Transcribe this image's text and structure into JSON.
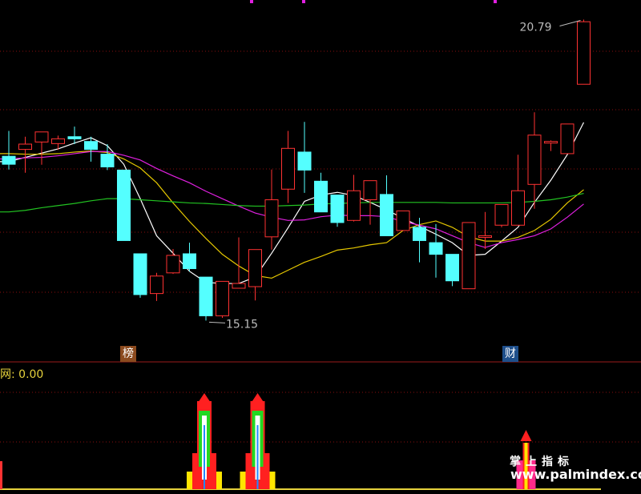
{
  "chart_data": [
    {
      "type": "candlestick",
      "grid": true,
      "ylim": [
        14.4,
        21.2
      ],
      "annotations": {
        "high": "20.79",
        "low": "15.15"
      },
      "candles": [
        {
          "o": 18.25,
          "h": 18.73,
          "l": 18.0,
          "c": 18.1
        },
        {
          "o": 18.38,
          "h": 18.62,
          "l": 17.94,
          "c": 18.48
        },
        {
          "o": 18.52,
          "h": 18.71,
          "l": 18.09,
          "c": 18.71
        },
        {
          "o": 18.49,
          "h": 18.64,
          "l": 18.37,
          "c": 18.58
        },
        {
          "o": 18.62,
          "h": 18.81,
          "l": 18.48,
          "c": 18.58
        },
        {
          "o": 18.53,
          "h": 18.62,
          "l": 18.15,
          "c": 18.38
        },
        {
          "o": 18.29,
          "h": 18.48,
          "l": 17.99,
          "c": 18.05
        },
        {
          "o": 17.99,
          "h": 17.99,
          "l": 16.66,
          "c": 16.66
        },
        {
          "o": 16.41,
          "h": 16.41,
          "l": 15.58,
          "c": 15.64
        },
        {
          "o": 15.66,
          "h": 16.05,
          "l": 15.52,
          "c": 15.99
        },
        {
          "o": 16.05,
          "h": 16.5,
          "l": 16.03,
          "c": 16.38
        },
        {
          "o": 16.41,
          "h": 16.62,
          "l": 16.08,
          "c": 16.13
        },
        {
          "o": 15.97,
          "h": 15.97,
          "l": 15.15,
          "c": 15.24
        },
        {
          "o": 15.24,
          "h": 15.89,
          "l": 15.2,
          "c": 15.89
        },
        {
          "o": 15.76,
          "h": 16.72,
          "l": 15.82,
          "c": 15.85
        },
        {
          "o": 15.79,
          "h": 16.49,
          "l": 15.53,
          "c": 16.49
        },
        {
          "o": 16.73,
          "h": 18.0,
          "l": 16.49,
          "c": 17.43
        },
        {
          "o": 17.63,
          "h": 18.73,
          "l": 17.37,
          "c": 18.4
        },
        {
          "o": 18.33,
          "h": 18.9,
          "l": 17.56,
          "c": 17.99
        },
        {
          "o": 17.78,
          "h": 17.94,
          "l": 17.2,
          "c": 17.2
        },
        {
          "o": 17.52,
          "h": 17.52,
          "l": 16.92,
          "c": 17.0
        },
        {
          "o": 17.04,
          "h": 17.9,
          "l": 17.02,
          "c": 17.6
        },
        {
          "o": 17.43,
          "h": 17.79,
          "l": 16.96,
          "c": 17.79
        },
        {
          "o": 17.53,
          "h": 17.89,
          "l": 16.75,
          "c": 16.75
        },
        {
          "o": 16.85,
          "h": 17.22,
          "l": 16.87,
          "c": 17.22
        },
        {
          "o": 16.91,
          "h": 17.09,
          "l": 16.25,
          "c": 16.66
        },
        {
          "o": 16.62,
          "h": 16.97,
          "l": 15.96,
          "c": 16.4
        },
        {
          "o": 16.4,
          "h": 16.4,
          "l": 15.8,
          "c": 15.9
        },
        {
          "o": 15.75,
          "h": 17.0,
          "l": 15.75,
          "c": 17.0
        },
        {
          "o": 16.75,
          "h": 17.2,
          "l": 16.5,
          "c": 16.75
        },
        {
          "o": 16.95,
          "h": 17.34,
          "l": 16.91,
          "c": 17.34
        },
        {
          "o": 16.95,
          "h": 18.28,
          "l": 16.95,
          "c": 17.6
        },
        {
          "o": 17.72,
          "h": 19.08,
          "l": 17.26,
          "c": 18.65
        },
        {
          "o": 18.51,
          "h": 18.55,
          "l": 18.35,
          "c": 18.53
        },
        {
          "o": 18.3,
          "h": 18.86,
          "l": 18.3,
          "c": 18.86
        },
        {
          "o": 19.61,
          "h": 20.83,
          "l": 19.61,
          "c": 20.79
        }
      ],
      "ma_lines": [
        {
          "color": "#ffffff",
          "values": [
            18.15,
            18.23,
            18.31,
            18.39,
            18.5,
            18.6,
            18.45,
            18.1,
            17.45,
            16.75,
            16.42,
            16.08,
            15.87,
            15.85,
            15.85,
            15.97,
            16.42,
            16.9,
            17.4,
            17.52,
            17.57,
            17.51,
            17.38,
            17.24,
            17.08,
            16.93,
            16.78,
            16.62,
            16.38,
            16.4,
            16.65,
            16.91,
            17.38,
            17.8,
            18.28,
            18.89
          ]
        },
        {
          "color": "#e6c800",
          "values": [
            18.3,
            18.29,
            18.29,
            18.3,
            18.33,
            18.35,
            18.32,
            18.2,
            18.03,
            17.75,
            17.37,
            17.02,
            16.7,
            16.4,
            16.18,
            16.0,
            15.95,
            16.1,
            16.25,
            16.36,
            16.48,
            16.52,
            16.58,
            16.62,
            16.85,
            16.96,
            17.03,
            16.91,
            16.73,
            16.65,
            16.65,
            16.72,
            16.85,
            17.06,
            17.37,
            17.62
          ]
        },
        {
          "color": "#e020e0",
          "values": [
            18.2,
            18.22,
            18.23,
            18.26,
            18.3,
            18.34,
            18.34,
            18.27,
            18.18,
            18.02,
            17.88,
            17.75,
            17.59,
            17.45,
            17.31,
            17.18,
            17.1,
            17.04,
            17.05,
            17.11,
            17.14,
            17.13,
            17.13,
            17.11,
            17.02,
            16.95,
            16.88,
            16.75,
            16.62,
            16.53,
            16.62,
            16.68,
            16.75,
            16.88,
            17.1,
            17.35
          ]
        },
        {
          "color": "#22c422",
          "values": [
            17.2,
            17.23,
            17.28,
            17.32,
            17.36,
            17.41,
            17.45,
            17.45,
            17.43,
            17.41,
            17.39,
            17.37,
            17.36,
            17.34,
            17.32,
            17.31,
            17.31,
            17.32,
            17.33,
            17.35,
            17.36,
            17.37,
            17.38,
            17.38,
            17.38,
            17.38,
            17.38,
            17.37,
            17.37,
            17.37,
            17.37,
            17.38,
            17.4,
            17.43,
            17.48,
            17.55
          ]
        }
      ],
      "event_tags": [
        {
          "index": 7,
          "label": "榜"
        },
        {
          "index": 29,
          "label": "财"
        }
      ]
    },
    {
      "type": "indicator",
      "title": "网: 0.00",
      "signals": [
        12,
        15,
        31
      ],
      "signal_strength": [
        1.0,
        1.0,
        0.6
      ]
    }
  ],
  "watermark": {
    "cn": "掌上指标",
    "en": "www.palmindex.com"
  }
}
